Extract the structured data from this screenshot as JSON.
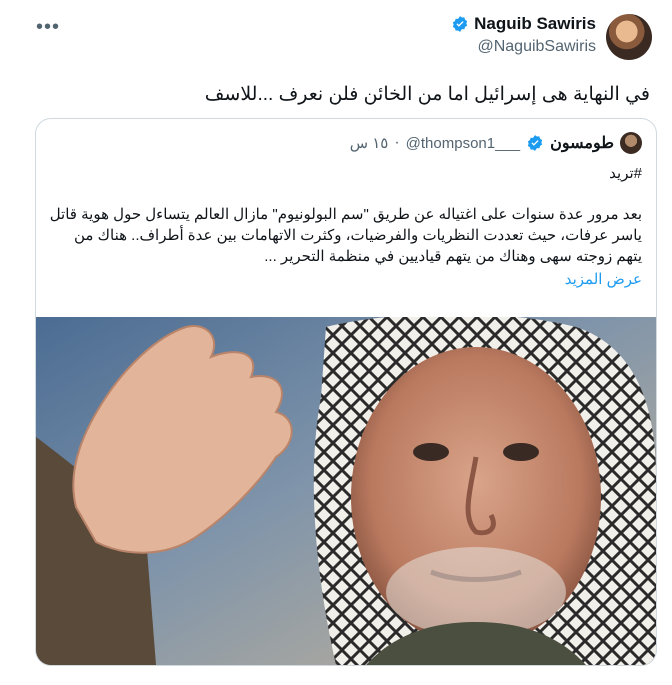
{
  "tweet": {
    "display_name": "Naguib Sawiris",
    "handle": "@NaguibSawiris",
    "text": "في النهاية هى إسرائيل اما من الخائن فلن نعرف ...للاسف",
    "more_label": "•••"
  },
  "quote": {
    "display_name": "طومسون",
    "handle": "@thompson1___",
    "separator": "·",
    "time": "١٥ س",
    "hashtag": "#تريد",
    "body": "بعد مرور عدة سنوات على اغتياله عن طريق \"سم البولونيوم\" مازال العالم يتساءل حول هوية قاتل ياسر عرفات، حيث تعددت النظريات والفرضيات، وكثرت الاتهامات بين عدة أطراف.. هناك من يتهم زوجته سهى وهناك من يتهم قياديين في منظمة التحرير ...",
    "show_more": "عرض المزيد"
  },
  "colors": {
    "verified": "#1d9bf0",
    "link": "#1d9bf0",
    "muted": "#536471"
  },
  "icons": {
    "more": "more-horizontal-icon",
    "verified": "verified-badge-icon"
  }
}
